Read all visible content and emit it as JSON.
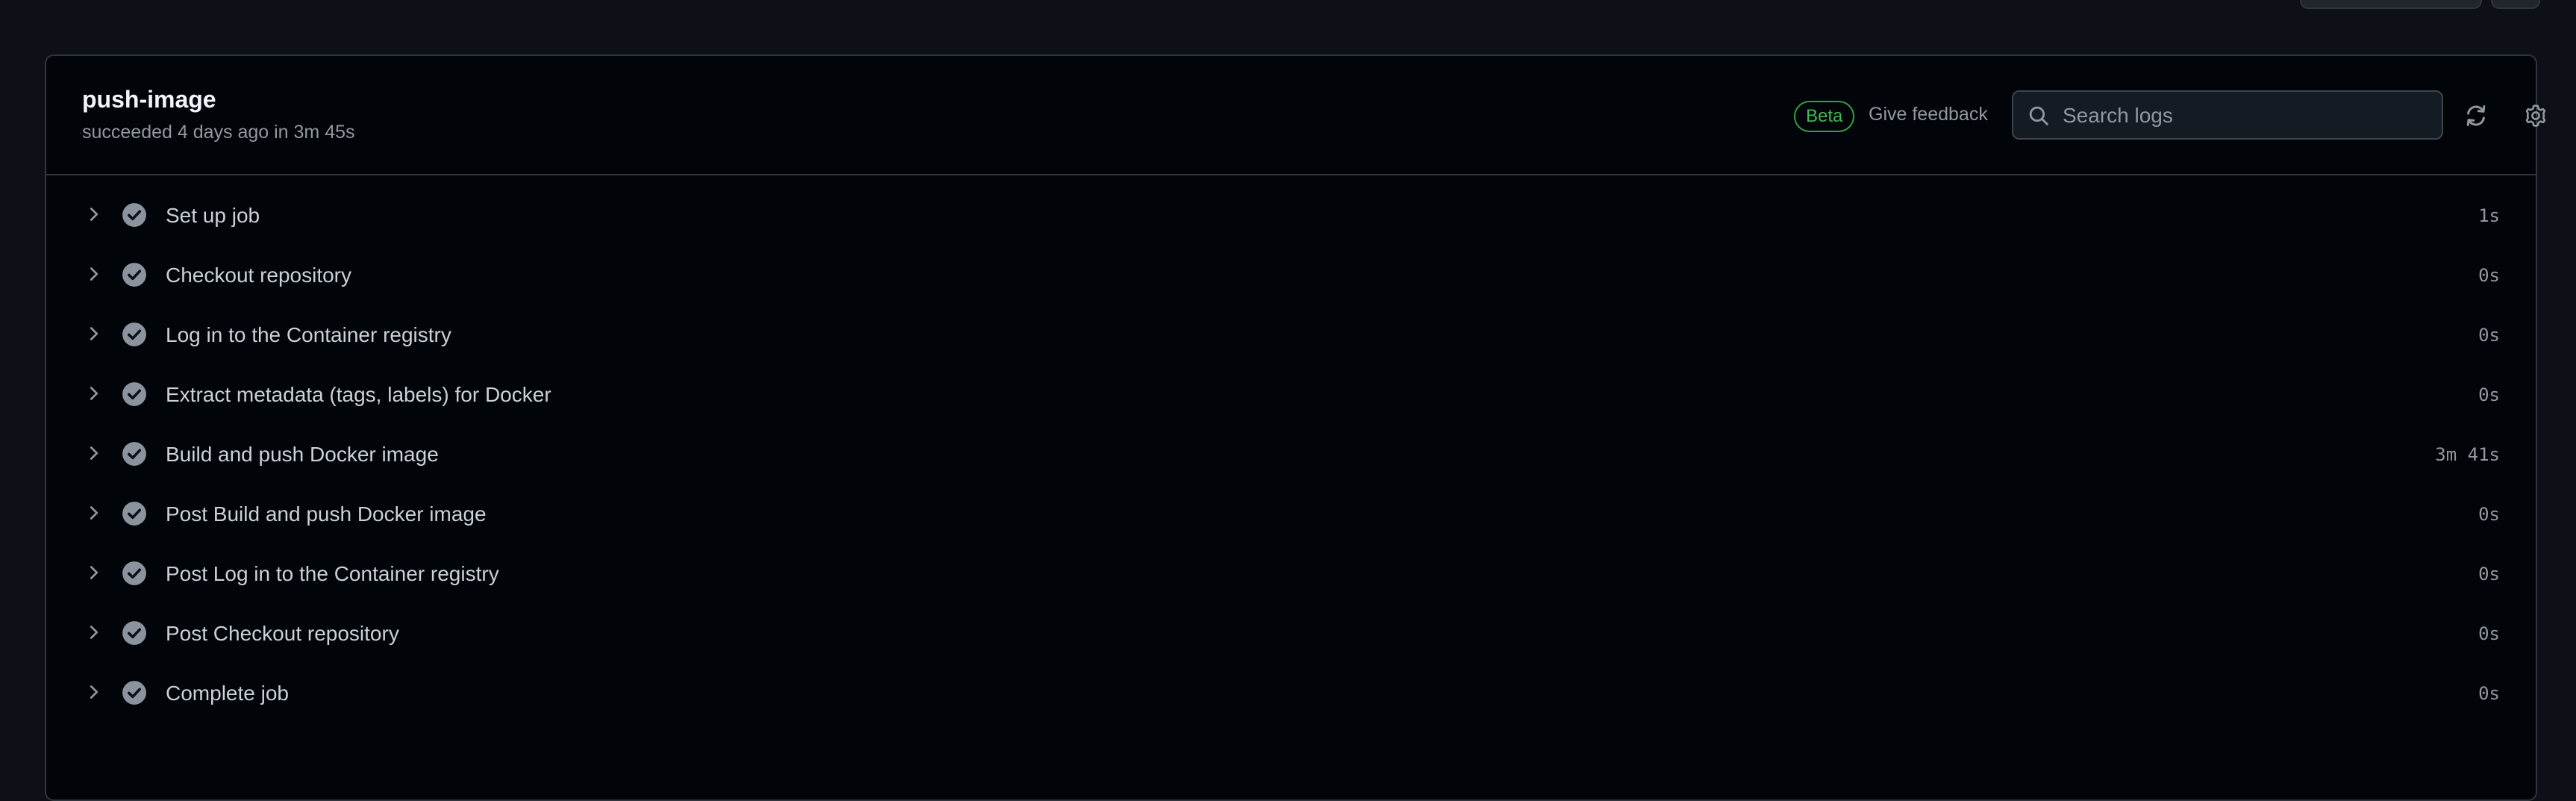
{
  "job": {
    "name": "push-image",
    "status_line": "succeeded 4 days ago in 3m 45s"
  },
  "header": {
    "beta_badge": "Beta",
    "feedback_link": "Give feedback",
    "search_placeholder": "Search logs",
    "refresh_icon": "sync-icon",
    "settings_icon": "gear-icon"
  },
  "steps": [
    {
      "name": "Set up job",
      "duration": "1s"
    },
    {
      "name": "Checkout repository",
      "duration": "0s"
    },
    {
      "name": "Log in to the Container registry",
      "duration": "0s"
    },
    {
      "name": "Extract metadata (tags, labels) for Docker",
      "duration": "0s"
    },
    {
      "name": "Build and push Docker image",
      "duration": "3m 41s"
    },
    {
      "name": "Post Build and push Docker image",
      "duration": "0s"
    },
    {
      "name": "Post Log in to the Container registry",
      "duration": "0s"
    },
    {
      "name": "Post Checkout repository",
      "duration": "0s"
    },
    {
      "name": "Complete job",
      "duration": "0s"
    }
  ],
  "colors": {
    "background": "#0d1117",
    "panel": "#010409",
    "border": "#30363d",
    "beta_green": "#3fb950",
    "muted_text": "#9198a1"
  }
}
